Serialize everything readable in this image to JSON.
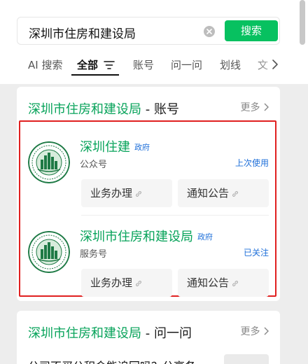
{
  "search": {
    "query": "深圳市住房和建设局",
    "button_label": "搜索"
  },
  "tabs": [
    {
      "label": "AI 搜索",
      "active": false
    },
    {
      "label": "全部",
      "active": true
    },
    {
      "label": "账号",
      "active": false
    },
    {
      "label": "问一问",
      "active": false
    },
    {
      "label": "划线",
      "active": false
    },
    {
      "label": "文",
      "active": false
    }
  ],
  "account_card": {
    "title_highlight": "深圳市住房和建设局",
    "title_suffix": " - 账号",
    "more_label": "更多",
    "accounts": [
      {
        "name": "深圳住建",
        "badge": "政府",
        "type": "公众号",
        "status": "上次使用",
        "buttons": [
          "业务办理",
          "通知公告"
        ]
      },
      {
        "name": "深圳市住房和建设局",
        "badge": "政府",
        "type": "服务号",
        "status": "已关注",
        "buttons": [
          "业务办理",
          "通知公告"
        ]
      }
    ]
  },
  "qa_card": {
    "title_highlight": "深圳市住房和建设局",
    "title_suffix": " - 问一问",
    "more_label": "更多",
    "first_question": "公司不买公积金能追回吗？分享各"
  },
  "colors": {
    "accent_green": "#07c160",
    "highlight_green": "#07a35a",
    "badge_blue": "#1e6fd9",
    "selection_red": "#e02020"
  }
}
